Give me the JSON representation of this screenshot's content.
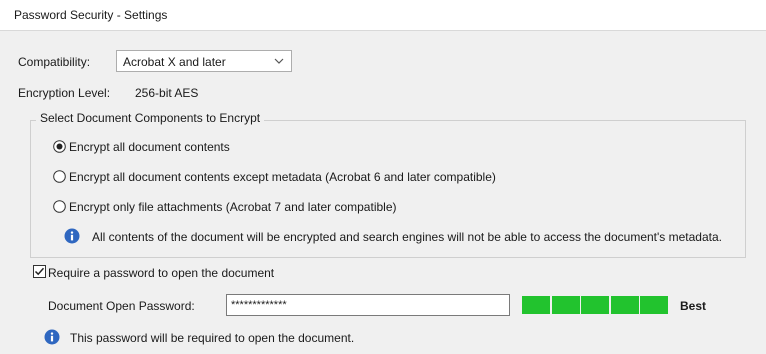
{
  "window": {
    "title": "Password Security - Settings"
  },
  "compatibility": {
    "label": "Compatibility:",
    "selected": "Acrobat X and later"
  },
  "encryption": {
    "label": "Encryption Level:",
    "value": "256-bit AES"
  },
  "components": {
    "group_label": "Select Document Components to Encrypt",
    "options": [
      {
        "label": "Encrypt all document contents",
        "selected": true
      },
      {
        "label": "Encrypt all document contents except metadata (Acrobat 6 and later compatible)",
        "selected": false
      },
      {
        "label": "Encrypt only file attachments (Acrobat 7 and later compatible)",
        "selected": false
      }
    ],
    "info_text": "All contents of the document will be encrypted and search engines will not be able to access the document's metadata."
  },
  "open_password": {
    "require_label": "Require a password to open the document",
    "checked": true,
    "field_label": "Document Open Password:",
    "value": "*************",
    "strength": {
      "level": 5,
      "max": 5,
      "label": "Best",
      "color": "#22c32e"
    },
    "info_text": "This password will be required to open the document."
  },
  "icons": {
    "info": "info-icon",
    "dropdown": "chevron-down-icon",
    "check": "check-icon"
  },
  "colors": {
    "info_blue": "#2f67c0",
    "meter_green": "#22c32e"
  }
}
